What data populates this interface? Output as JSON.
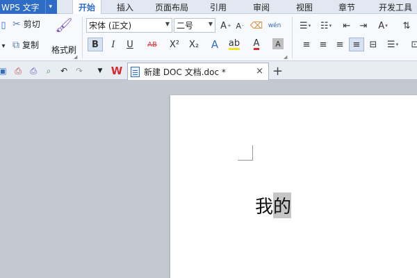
{
  "app": {
    "name": "WPS 文字",
    "menu_caret": "▾"
  },
  "tabs": [
    {
      "label": "开始",
      "active": true
    },
    {
      "label": "插入"
    },
    {
      "label": "页面布局"
    },
    {
      "label": "引用"
    },
    {
      "label": "审阅"
    },
    {
      "label": "视图"
    },
    {
      "label": "章节"
    },
    {
      "label": "开发工具"
    }
  ],
  "clipboard": {
    "cut": "剪切",
    "copy": "复制",
    "format_painter": "格式刷"
  },
  "font": {
    "name": "宋体 (正文)",
    "size": "二号"
  },
  "format_buttons": {
    "bold": "B",
    "italic": "I",
    "underline": "U",
    "strike": "AB",
    "superscript": "X²",
    "subscript": "X₂"
  },
  "doc_tab": {
    "title": "新建 DOC 文档.doc *",
    "close": "×",
    "new": "+"
  },
  "document": {
    "char1": "我",
    "char2": "的"
  },
  "colors": {
    "accent": "#2f6cc6",
    "wps_red": "#d9282f",
    "workspace": "#c4c9d1"
  }
}
